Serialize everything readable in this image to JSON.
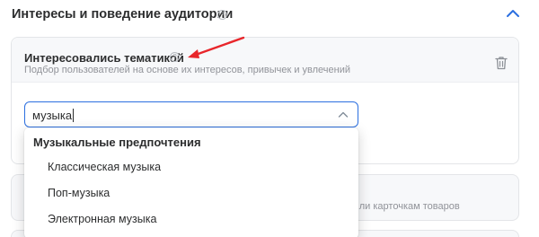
{
  "section": {
    "title": "Интересы и поведение аудитории",
    "help_glyph": "?"
  },
  "interest_card": {
    "title": "Интересовались тематикой",
    "subtitle": "Подбор пользователей на основе их интересов, привычек и увлечений",
    "help_glyph": "?"
  },
  "search": {
    "value": "музыка"
  },
  "dropdown": {
    "group_label": "Музыкальные предпочтения",
    "options": [
      "Классическая музыка",
      "Поп-музыка",
      "Электронная музыка"
    ]
  },
  "second_card": {
    "subtitle_fragment": "м или карточкам товаров"
  },
  "colors": {
    "accent": "#2b6fe0",
    "annotation_arrow": "#e8262b",
    "card_header_bg": "#f7f8fa"
  }
}
